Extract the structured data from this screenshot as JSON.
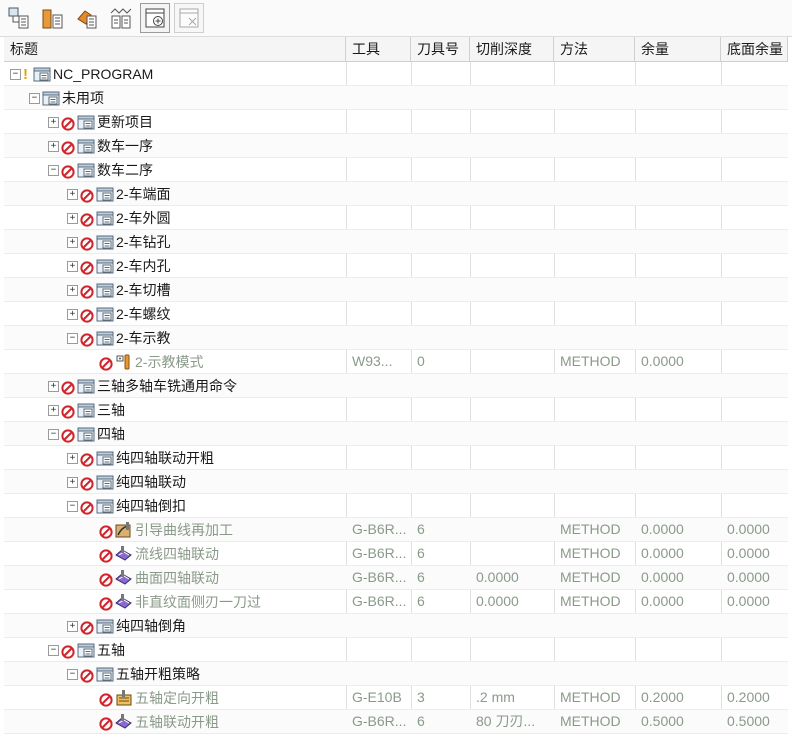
{
  "toolbar": {
    "buttons": [
      {
        "name": "program-order-view-icon"
      },
      {
        "name": "machine-tool-view-icon"
      },
      {
        "name": "geometry-view-icon"
      },
      {
        "name": "machining-method-view-icon"
      },
      {
        "name": "create-program-icon"
      },
      {
        "name": "delete-program-icon"
      }
    ]
  },
  "columns": [
    "标题",
    "工具",
    "刀具号",
    "切削深度",
    "方法",
    "余量",
    "底面余量"
  ],
  "rows": [
    {
      "level": 0,
      "exp": "-",
      "warn": true,
      "noentry": false,
      "icon": "folder",
      "title": "NC_PROGRAM",
      "tool": "",
      "tnum": "",
      "depth": "",
      "method": "",
      "stock": "",
      "floor": "",
      "gray": false
    },
    {
      "level": 1,
      "exp": "-",
      "warn": false,
      "noentry": false,
      "icon": "folder",
      "title": "未用项",
      "tool": "",
      "tnum": "",
      "depth": "",
      "method": "",
      "stock": "",
      "floor": "",
      "gray": false
    },
    {
      "level": 2,
      "exp": "+",
      "warn": false,
      "noentry": true,
      "icon": "folder",
      "title": "更新项目",
      "tool": "",
      "tnum": "",
      "depth": "",
      "method": "",
      "stock": "",
      "floor": "",
      "gray": false
    },
    {
      "level": 2,
      "exp": "+",
      "warn": false,
      "noentry": true,
      "icon": "folder",
      "title": "数车一序",
      "tool": "",
      "tnum": "",
      "depth": "",
      "method": "",
      "stock": "",
      "floor": "",
      "gray": false
    },
    {
      "level": 2,
      "exp": "-",
      "warn": false,
      "noentry": true,
      "icon": "folder",
      "title": "数车二序",
      "tool": "",
      "tnum": "",
      "depth": "",
      "method": "",
      "stock": "",
      "floor": "",
      "gray": false
    },
    {
      "level": 3,
      "exp": "+",
      "warn": false,
      "noentry": true,
      "icon": "folder",
      "title": "2-车端面",
      "tool": "",
      "tnum": "",
      "depth": "",
      "method": "",
      "stock": "",
      "floor": "",
      "gray": false
    },
    {
      "level": 3,
      "exp": "+",
      "warn": false,
      "noentry": true,
      "icon": "folder",
      "title": "2-车外圆",
      "tool": "",
      "tnum": "",
      "depth": "",
      "method": "",
      "stock": "",
      "floor": "",
      "gray": false
    },
    {
      "level": 3,
      "exp": "+",
      "warn": false,
      "noentry": true,
      "icon": "folder",
      "title": "2-车钻孔",
      "tool": "",
      "tnum": "",
      "depth": "",
      "method": "",
      "stock": "",
      "floor": "",
      "gray": false
    },
    {
      "level": 3,
      "exp": "+",
      "warn": false,
      "noentry": true,
      "icon": "folder",
      "title": "2-车内孔",
      "tool": "",
      "tnum": "",
      "depth": "",
      "method": "",
      "stock": "",
      "floor": "",
      "gray": false
    },
    {
      "level": 3,
      "exp": "+",
      "warn": false,
      "noentry": true,
      "icon": "folder",
      "title": "2-车切槽",
      "tool": "",
      "tnum": "",
      "depth": "",
      "method": "",
      "stock": "",
      "floor": "",
      "gray": false
    },
    {
      "level": 3,
      "exp": "+",
      "warn": false,
      "noentry": true,
      "icon": "folder",
      "title": "2-车螺纹",
      "tool": "",
      "tnum": "",
      "depth": "",
      "method": "",
      "stock": "",
      "floor": "",
      "gray": false
    },
    {
      "level": 3,
      "exp": "-",
      "warn": false,
      "noentry": true,
      "icon": "folder",
      "title": "2-车示教",
      "tool": "",
      "tnum": "",
      "depth": "",
      "method": "",
      "stock": "",
      "floor": "",
      "gray": false
    },
    {
      "level": 4,
      "exp": "",
      "warn": false,
      "noentry": true,
      "icon": "op-teach",
      "title": "2-示教模式",
      "tool": "W93...",
      "tnum": "0",
      "depth": "",
      "method": "METHOD",
      "stock": "0.0000",
      "floor": "",
      "gray": true
    },
    {
      "level": 2,
      "exp": "+",
      "warn": false,
      "noentry": true,
      "icon": "folder",
      "title": "三轴多轴车铣通用命令",
      "tool": "",
      "tnum": "",
      "depth": "",
      "method": "",
      "stock": "",
      "floor": "",
      "gray": false
    },
    {
      "level": 2,
      "exp": "+",
      "warn": false,
      "noentry": true,
      "icon": "folder",
      "title": "三轴",
      "tool": "",
      "tnum": "",
      "depth": "",
      "method": "",
      "stock": "",
      "floor": "",
      "gray": false
    },
    {
      "level": 2,
      "exp": "-",
      "warn": false,
      "noentry": true,
      "icon": "folder",
      "title": "四轴",
      "tool": "",
      "tnum": "",
      "depth": "",
      "method": "",
      "stock": "",
      "floor": "",
      "gray": false
    },
    {
      "level": 3,
      "exp": "+",
      "warn": false,
      "noentry": true,
      "icon": "folder",
      "title": "纯四轴联动开粗",
      "tool": "",
      "tnum": "",
      "depth": "",
      "method": "",
      "stock": "",
      "floor": "",
      "gray": false
    },
    {
      "level": 3,
      "exp": "+",
      "warn": false,
      "noentry": true,
      "icon": "folder",
      "title": "纯四轴联动",
      "tool": "",
      "tnum": "",
      "depth": "",
      "method": "",
      "stock": "",
      "floor": "",
      "gray": false
    },
    {
      "level": 3,
      "exp": "-",
      "warn": false,
      "noentry": true,
      "icon": "folder",
      "title": "纯四轴倒扣",
      "tool": "",
      "tnum": "",
      "depth": "",
      "method": "",
      "stock": "",
      "floor": "",
      "gray": false
    },
    {
      "level": 4,
      "exp": "",
      "warn": false,
      "noentry": true,
      "icon": "op-guide",
      "title": "引导曲线再加工",
      "tool": "G-B6R...",
      "tnum": "6",
      "depth": "",
      "method": "METHOD",
      "stock": "0.0000",
      "floor": "0.0000",
      "gray": true
    },
    {
      "level": 4,
      "exp": "",
      "warn": false,
      "noentry": true,
      "icon": "op-flow",
      "title": "流线四轴联动",
      "tool": "G-B6R...",
      "tnum": "6",
      "depth": "",
      "method": "METHOD",
      "stock": "0.0000",
      "floor": "0.0000",
      "gray": true
    },
    {
      "level": 4,
      "exp": "",
      "warn": false,
      "noentry": true,
      "icon": "op-flow",
      "title": "曲面四轴联动",
      "tool": "G-B6R...",
      "tnum": "6",
      "depth": "0.0000",
      "method": "METHOD",
      "stock": "0.0000",
      "floor": "0.0000",
      "gray": true
    },
    {
      "level": 4,
      "exp": "",
      "warn": false,
      "noentry": true,
      "icon": "op-flow",
      "title": "非直纹面侧刃一刀过",
      "tool": "G-B6R...",
      "tnum": "6",
      "depth": "0.0000",
      "method": "METHOD",
      "stock": "0.0000",
      "floor": "0.0000",
      "gray": true
    },
    {
      "level": 3,
      "exp": "+",
      "warn": false,
      "noentry": true,
      "icon": "folder",
      "title": "纯四轴倒角",
      "tool": "",
      "tnum": "",
      "depth": "",
      "method": "",
      "stock": "",
      "floor": "",
      "gray": false
    },
    {
      "level": 2,
      "exp": "-",
      "warn": false,
      "noentry": true,
      "icon": "folder",
      "title": "五轴",
      "tool": "",
      "tnum": "",
      "depth": "",
      "method": "",
      "stock": "",
      "floor": "",
      "gray": false
    },
    {
      "level": 3,
      "exp": "-",
      "warn": false,
      "noentry": true,
      "icon": "folder",
      "title": "五轴开粗策略",
      "tool": "",
      "tnum": "",
      "depth": "",
      "method": "",
      "stock": "",
      "floor": "",
      "gray": false
    },
    {
      "level": 4,
      "exp": "",
      "warn": false,
      "noentry": true,
      "icon": "op-rough",
      "title": "五轴定向开粗",
      "tool": "G-E10B",
      "tnum": "3",
      "depth": ".2 mm",
      "method": "METHOD",
      "stock": "0.2000",
      "floor": "0.2000",
      "gray": true
    },
    {
      "level": 4,
      "exp": "",
      "warn": false,
      "noentry": true,
      "icon": "op-flow",
      "title": "五轴联动开粗",
      "tool": "G-B6R...",
      "tnum": "6",
      "depth": "80 刀刃...",
      "method": "METHOD",
      "stock": "0.5000",
      "floor": "0.5000",
      "gray": true
    }
  ]
}
